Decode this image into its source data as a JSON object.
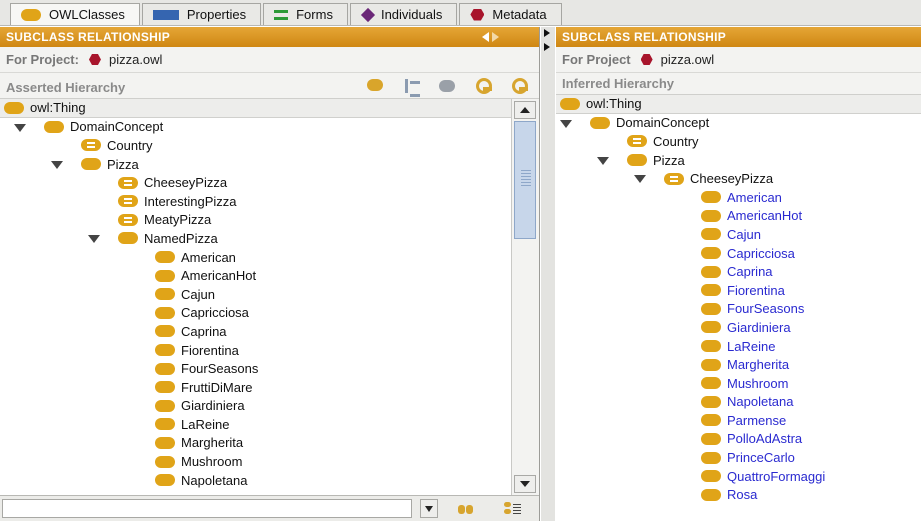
{
  "tabs": [
    {
      "label": "OWLClasses",
      "icon": "class-icon",
      "active": true
    },
    {
      "label": "Properties",
      "icon": "properties-icon",
      "active": false
    },
    {
      "label": "Forms",
      "icon": "forms-icon",
      "active": false
    },
    {
      "label": "Individuals",
      "icon": "individuals-icon",
      "active": false
    },
    {
      "label": "Metadata",
      "icon": "metadata-icon",
      "active": false
    }
  ],
  "left": {
    "title": "SUBCLASS RELATIONSHIP",
    "project_label": "For Project:",
    "project_name": "pizza.owl",
    "hierarchy_title": "Asserted Hierarchy",
    "tree": [
      {
        "label": "owl:Thing",
        "level": 0,
        "expander": false,
        "top": true
      },
      {
        "label": "DomainConcept",
        "level": 0,
        "expander": true
      },
      {
        "label": "Country",
        "level": 1,
        "expander": false,
        "defined": true
      },
      {
        "label": "Pizza",
        "level": 1,
        "expander": true
      },
      {
        "label": "CheeseyPizza",
        "level": 2,
        "expander": false,
        "defined": true
      },
      {
        "label": "InterestingPizza",
        "level": 2,
        "expander": false,
        "defined": true
      },
      {
        "label": "MeatyPizza",
        "level": 2,
        "expander": false,
        "defined": true
      },
      {
        "label": "NamedPizza",
        "level": 2,
        "expander": true
      },
      {
        "label": "American",
        "level": 3
      },
      {
        "label": "AmericanHot",
        "level": 3
      },
      {
        "label": "Cajun",
        "level": 3
      },
      {
        "label": "Capricciosa",
        "level": 3
      },
      {
        "label": "Caprina",
        "level": 3
      },
      {
        "label": "Fiorentina",
        "level": 3
      },
      {
        "label": "FourSeasons",
        "level": 3
      },
      {
        "label": "FruttiDiMare",
        "level": 3
      },
      {
        "label": "Giardiniera",
        "level": 3
      },
      {
        "label": "LaReine",
        "level": 3
      },
      {
        "label": "Margherita",
        "level": 3
      },
      {
        "label": "Mushroom",
        "level": 3
      },
      {
        "label": "Napoletana",
        "level": 3
      }
    ]
  },
  "right": {
    "title": "SUBCLASS RELATIONSHIP",
    "project_label": "For Project",
    "project_name": "pizza.owl",
    "hierarchy_title": "Inferred Hierarchy",
    "tree": [
      {
        "label": "owl:Thing",
        "level": 0,
        "expander": false,
        "top": true
      },
      {
        "label": "DomainConcept",
        "level": 0,
        "expander": true
      },
      {
        "label": "Country",
        "level": 1,
        "expander": false,
        "defined": true
      },
      {
        "label": "Pizza",
        "level": 1,
        "expander": true
      },
      {
        "label": "CheeseyPizza",
        "level": 2,
        "expander": true,
        "defined": true
      },
      {
        "label": "American",
        "level": 3,
        "blue": true
      },
      {
        "label": "AmericanHot",
        "level": 3,
        "blue": true
      },
      {
        "label": "Cajun",
        "level": 3,
        "blue": true
      },
      {
        "label": "Capricciosa",
        "level": 3,
        "blue": true
      },
      {
        "label": "Caprina",
        "level": 3,
        "blue": true
      },
      {
        "label": "Fiorentina",
        "level": 3,
        "blue": true
      },
      {
        "label": "FourSeasons",
        "level": 3,
        "blue": true
      },
      {
        "label": "Giardiniera",
        "level": 3,
        "blue": true
      },
      {
        "label": "LaReine",
        "level": 3,
        "blue": true
      },
      {
        "label": "Margherita",
        "level": 3,
        "blue": true
      },
      {
        "label": "Mushroom",
        "level": 3,
        "blue": true
      },
      {
        "label": "Napoletana",
        "level": 3,
        "blue": true
      },
      {
        "label": "Parmense",
        "level": 3,
        "blue": true
      },
      {
        "label": "PolloAdAstra",
        "level": 3,
        "blue": true
      },
      {
        "label": "PrinceCarlo",
        "level": 3,
        "blue": true
      },
      {
        "label": "QuattroFormaggi",
        "level": 3,
        "blue": true
      },
      {
        "label": "Rosa",
        "level": 3,
        "blue": true
      }
    ]
  },
  "toolbar_icons": [
    "create-subclass-icon",
    "create-sibling-icon",
    "delete-class-icon",
    "add-superclass-icon",
    "remove-superclass-icon"
  ],
  "colors": {
    "title_bar": "#d9951f",
    "class_icon": "#e0a418",
    "inferred_text": "#2a2ad0"
  }
}
